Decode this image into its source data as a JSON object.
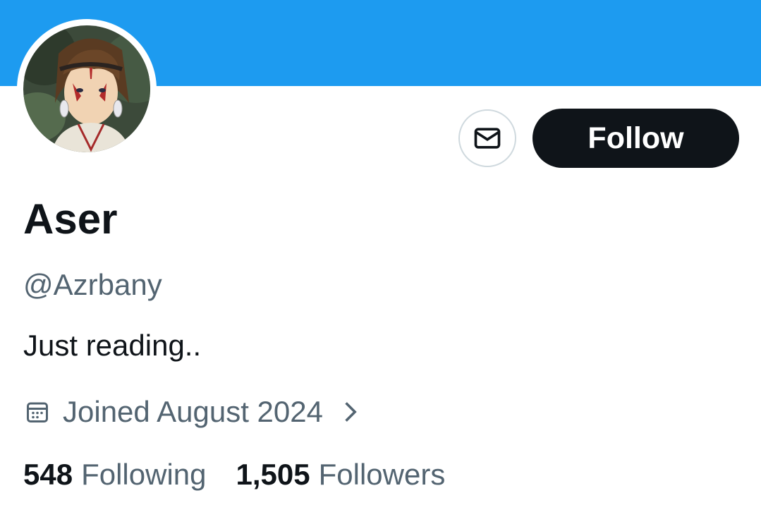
{
  "profile": {
    "display_name": "Aser",
    "handle": "@Azrbany",
    "bio": "Just reading..",
    "joined": "Joined August 2024",
    "banner_color": "#1d9bf0"
  },
  "actions": {
    "message_icon": "envelope-icon",
    "follow_label": "Follow"
  },
  "stats": {
    "following_count": "548",
    "following_label": "Following",
    "followers_count": "1,505",
    "followers_label": "Followers"
  },
  "icons": {
    "joined": "calendar-icon",
    "expand": "chevron-right-icon"
  }
}
